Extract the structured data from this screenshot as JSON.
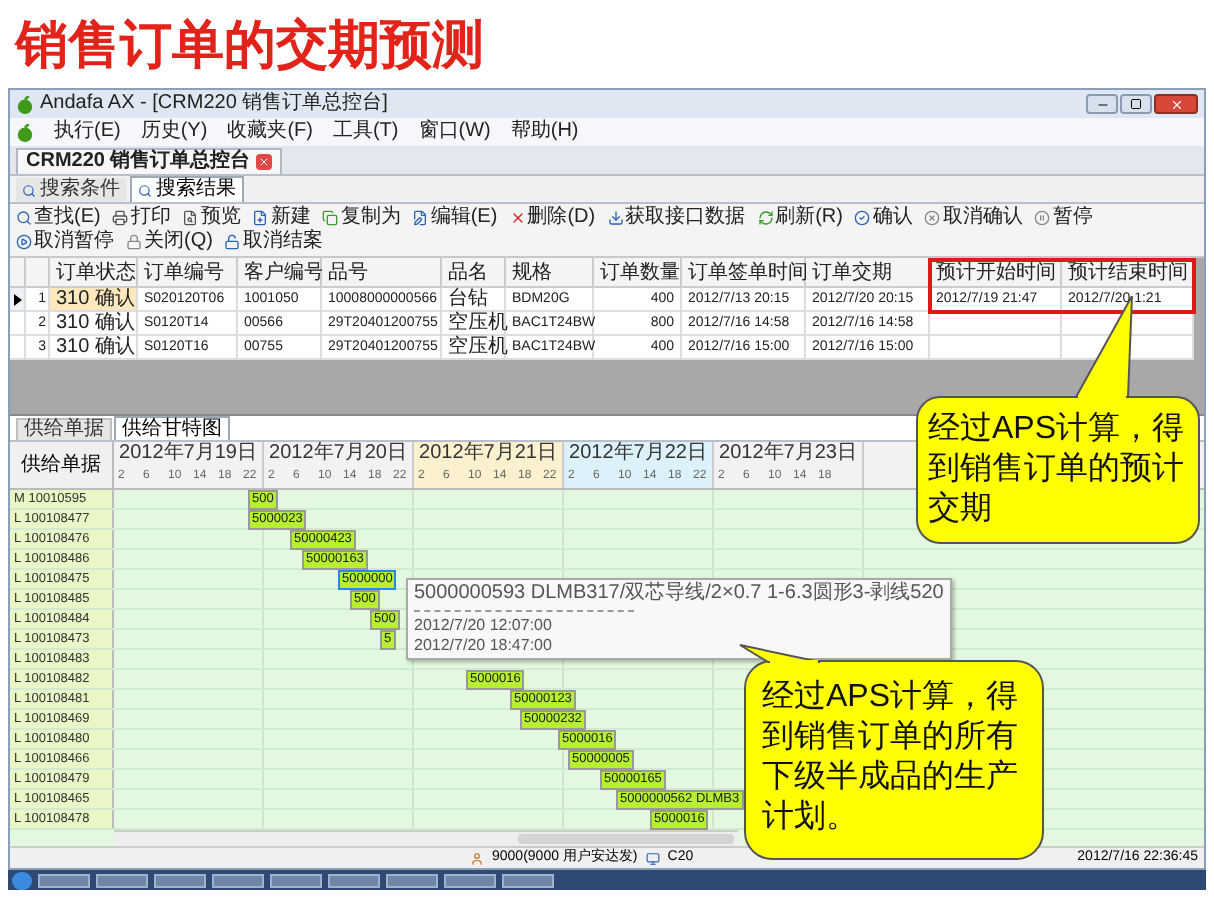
{
  "slide_title": "销售订单的交期预测",
  "window": {
    "title": "Andafa AX - [CRM220 销售订单总控台]"
  },
  "menu": [
    "执行(E)",
    "历史(Y)",
    "收藏夹(F)",
    "工具(T)",
    "窗口(W)",
    "帮助(H)"
  ],
  "document_tab": {
    "label": "CRM220 销售订单总控台"
  },
  "search_tabs": [
    {
      "label": "搜索条件",
      "selected": false
    },
    {
      "label": "搜索结果",
      "selected": true
    }
  ],
  "toolbar": [
    {
      "kind": "find",
      "label": "查找(E)"
    },
    {
      "kind": "print",
      "label": "打印"
    },
    {
      "kind": "preview",
      "label": "预览"
    },
    {
      "kind": "new",
      "label": "新建"
    },
    {
      "kind": "copy",
      "label": "复制为"
    },
    {
      "kind": "edit",
      "label": "编辑(E)"
    },
    {
      "kind": "delete",
      "label": "删除(D)"
    },
    {
      "kind": "fetch",
      "label": "获取接口数据"
    },
    {
      "kind": "refresh",
      "label": "刷新(R)"
    },
    {
      "kind": "confirm",
      "label": "确认"
    },
    {
      "kind": "unconfirm",
      "label": "取消确认"
    },
    {
      "kind": "pause",
      "label": "暂停"
    },
    {
      "kind": "resume",
      "label": "取消暂停"
    },
    {
      "kind": "close",
      "label": "关闭(Q)"
    },
    {
      "kind": "reopen",
      "label": "取消结案"
    }
  ],
  "table": {
    "columns": [
      "订单状态",
      "订单编号",
      "客户编号",
      "品号",
      "品名",
      "规格",
      "订单数量",
      "订单签单时间",
      "订单交期",
      "预计开始时间",
      "预计结束时间"
    ],
    "rows": [
      {
        "number": "1",
        "selected": true,
        "cells": [
          "310 确认",
          "S020120T06",
          "1001050",
          "10008000000566",
          "台钻",
          "BDM20G",
          "400",
          "2012/7/13 20:15",
          "2012/7/20 20:15",
          "2012/7/19 21:47",
          "2012/7/20 1:21"
        ]
      },
      {
        "number": "2",
        "selected": false,
        "cells": [
          "310 确认",
          "S0120T14",
          "00566",
          "29T20401200755",
          "空压机",
          "BAC1T24BW",
          "800",
          "2012/7/16 14:58",
          "2012/7/16 14:58"
        ]
      },
      {
        "number": "3",
        "selected": false,
        "cells": [
          "310 确认",
          "S0120T16",
          "00755",
          "29T20401200755",
          "空压机",
          "BAC1T24BW",
          "400",
          "2012/7/16 15:00",
          "2012/7/16 15:00"
        ]
      }
    ]
  },
  "bottom_tabs": [
    {
      "label": "供给单据",
      "selected": false
    },
    {
      "label": "供给甘特图",
      "selected": true
    }
  ],
  "gantt": {
    "label_header": "供给单据",
    "days": [
      {
        "label": "2012年7月19日",
        "color": "#f2f2f2",
        "hours": [
          "2",
          "6",
          "10",
          "14",
          "18",
          "22"
        ]
      },
      {
        "label": "2012年7月20日",
        "color": "#f2f2f2",
        "hours": [
          "2",
          "6",
          "10",
          "14",
          "18",
          "22"
        ]
      },
      {
        "label": "2012年7月21日",
        "color": "#fbf1cf",
        "hours": [
          "2",
          "6",
          "10",
          "14",
          "18",
          "22"
        ]
      },
      {
        "label": "2012年7月22日",
        "color": "#dcf1fa",
        "hours": [
          "2",
          "6",
          "10",
          "14",
          "18",
          "22"
        ]
      },
      {
        "label": "2012年7月23日",
        "color": "#f2f2f2",
        "hours": [
          "2",
          "6",
          "10",
          "14",
          "18"
        ]
      }
    ],
    "rows": [
      {
        "label": "M 10010595",
        "bar": {
          "text": "500",
          "selected": false
        }
      },
      {
        "label": "L 100108477",
        "bar": {
          "text": "5000023",
          "selected": false
        }
      },
      {
        "label": "L 100108476",
        "bar": {
          "text": "50000423",
          "selected": false
        }
      },
      {
        "label": "L 100108486",
        "bar": {
          "text": "50000163",
          "selected": false
        }
      },
      {
        "label": "L 100108475",
        "bar": {
          "text": "5000000",
          "selected": true
        }
      },
      {
        "label": "L 100108485",
        "bar": {
          "text": "500",
          "selected": false
        }
      },
      {
        "label": "L 100108484",
        "bar": {
          "text": "500",
          "selected": false
        }
      },
      {
        "label": "L 100108473",
        "bar": {
          "text": "5",
          "selected": false
        }
      },
      {
        "label": "L 100108483"
      },
      {
        "label": "L 100108482",
        "bar": {
          "text": "5000016",
          "selected": false
        }
      },
      {
        "label": "L 100108481",
        "bar": {
          "text": "50000123",
          "selected": false
        }
      },
      {
        "label": "L 100108469",
        "bar": {
          "text": "50000232",
          "selected": false
        }
      },
      {
        "label": "L 100108480",
        "bar": {
          "text": "5000016",
          "selected": false
        }
      },
      {
        "label": "L 100108466",
        "bar": {
          "text": "50000005",
          "selected": false
        }
      },
      {
        "label": "L 100108479",
        "bar": {
          "text": "50000165",
          "selected": false
        }
      },
      {
        "label": "L 100108465",
        "bar": {
          "text": "5000000562 DLMB3",
          "selected": false
        }
      },
      {
        "label": "L 100108478",
        "bar": {
          "text": "5000016",
          "selected": false
        }
      }
    ]
  },
  "tooltip": {
    "title": "5000000593 DLMB317/双芯导线/2×0.7 1-6.3圆形3-剥线520",
    "lines": [
      "2012/7/20 12:07:00",
      "2012/7/20 18:47:00"
    ]
  },
  "status_bar": {
    "user": "9000(9000 用户安达发)",
    "server": "C20",
    "time": "2012/7/16 22:36:45"
  },
  "callouts": [
    {
      "text": "经过APS计算，得到销售订单的预计交期"
    },
    {
      "text": "经过APS计算，得到销售订单的所有下级半成品的生产计划。"
    }
  ]
}
